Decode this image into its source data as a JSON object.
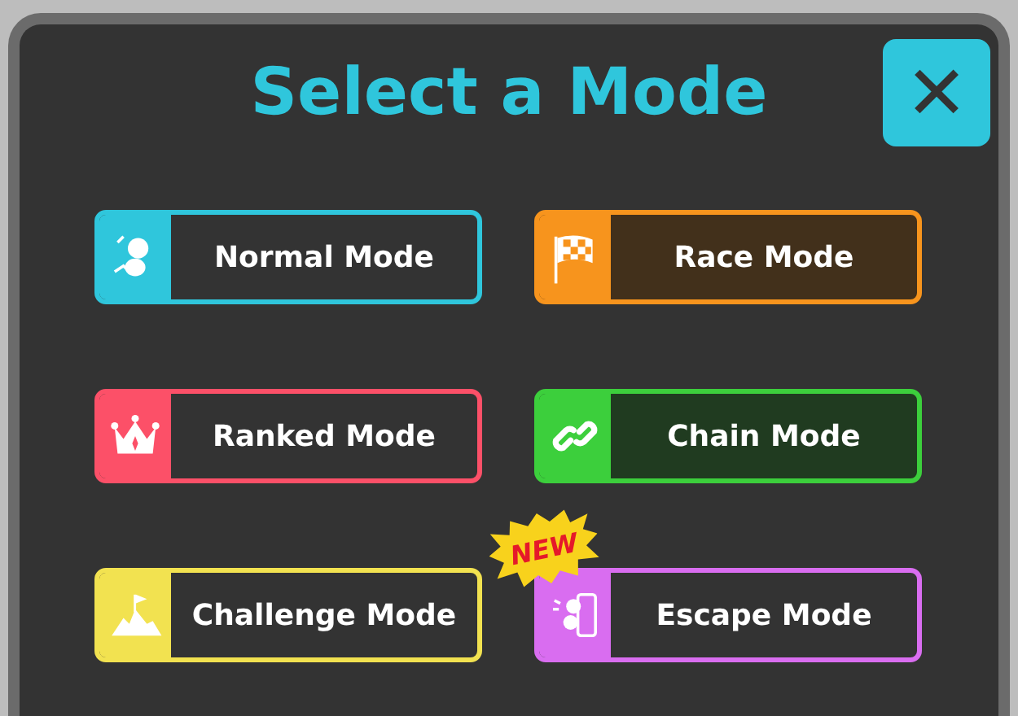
{
  "dialog": {
    "title": "Select a Mode",
    "close_label": "✕"
  },
  "modes": [
    {
      "label": "Normal Mode",
      "kind": "normal",
      "color": "#2fc6dc",
      "highlighted": false
    },
    {
      "label": "Race Mode",
      "kind": "race",
      "color": "#f7941d",
      "highlighted": true
    },
    {
      "label": "Ranked Mode",
      "kind": "ranked",
      "color": "#fc5068",
      "highlighted": false
    },
    {
      "label": "Chain Mode",
      "kind": "chain",
      "color": "#3ccf3c",
      "highlighted": true
    },
    {
      "label": "Challenge Mode",
      "kind": "challenge",
      "color": "#f2e250",
      "highlighted": false
    },
    {
      "label": "Escape Mode",
      "kind": "escape",
      "color": "#d96df0",
      "highlighted": false,
      "badge": "NEW"
    }
  ]
}
